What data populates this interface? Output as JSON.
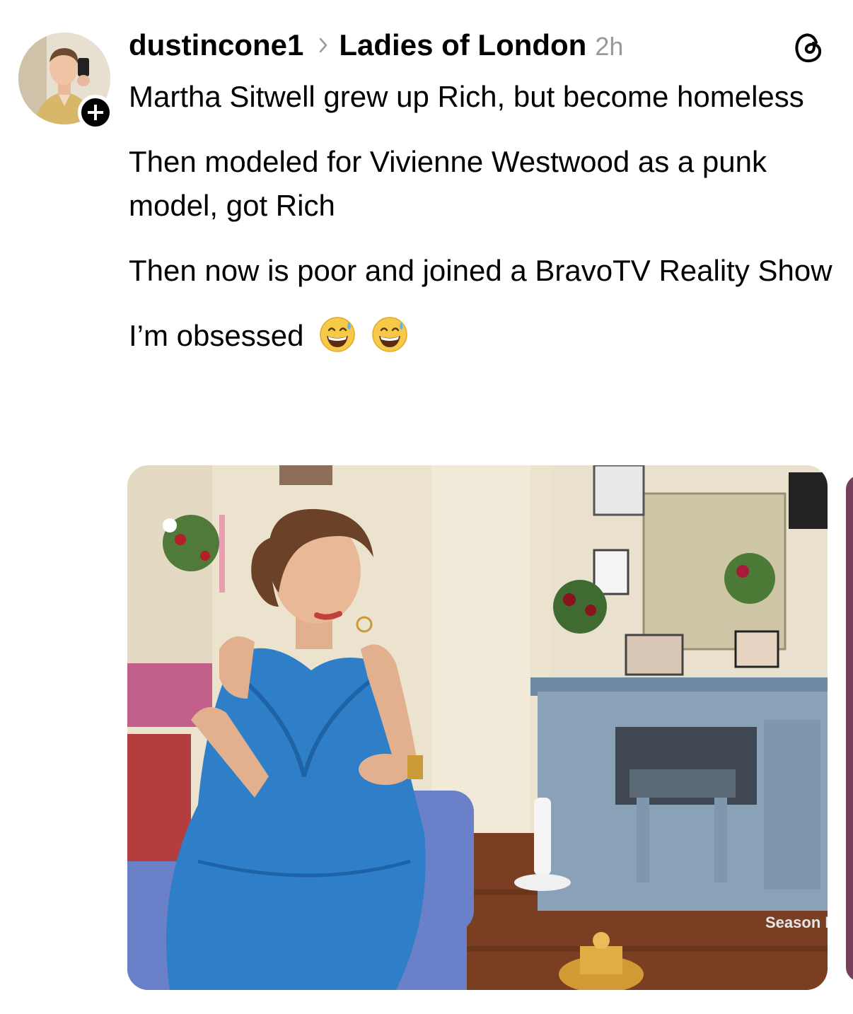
{
  "post": {
    "username": "dustincone1",
    "community": "Ladies of London",
    "timestamp": "2h",
    "paragraphs": [
      "Martha Sitwell grew up Rich, but become homeless",
      "Then modeled for Vivienne Westwood as a punk model, got Rich",
      "Then now is poor and joined a BravoTV Reality Show",
      "I’m obsessed"
    ],
    "emojis": [
      "grinning-face-with-sweat",
      "grinning-face-with-sweat"
    ],
    "media": {
      "overlay_text": "Season F"
    }
  },
  "icons": {
    "follow": "plus-icon",
    "app": "threads-logo-icon",
    "separator": "chevron-right-icon"
  },
  "colors": {
    "text": "#000000",
    "timestamp": "#999999",
    "dress": "#2f7fc8",
    "next_media_peek": "#74405a"
  }
}
